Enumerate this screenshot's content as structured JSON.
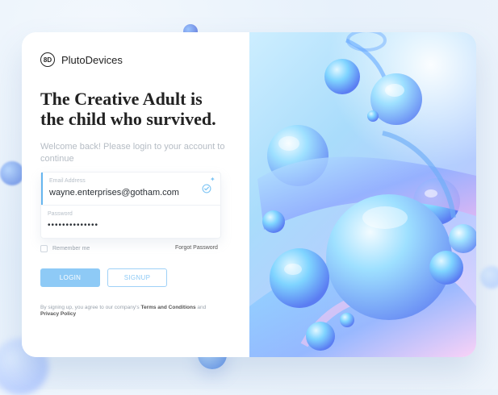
{
  "brand": {
    "name": "PlutoDevices",
    "logo_text": "8D"
  },
  "headline": {
    "line1": "The Creative Adult is",
    "line2": "the child who survived."
  },
  "intro": {
    "text": "Welcome back! Please login to your account to continue"
  },
  "form": {
    "email_label": "Email Address",
    "email_value": "wayne.enterprises@gotham.com",
    "password_label": "Password",
    "password_value": "••••••••••••••",
    "remember_label": "Remember me",
    "forgot_label": "Forgot Password"
  },
  "actions": {
    "login_label": "LOGIN",
    "signup_label": "SIGNUP"
  },
  "footer": {
    "terms_prefix": "By signing up, you agree to our company's ",
    "terms_link": "Terms and Conditions",
    "terms_middle": " and ",
    "privacy_link": "Privacy Policy"
  },
  "colors": {
    "accent": "#8ecaf6",
    "text_dark": "#222222",
    "text_muted": "#b5bcc4"
  },
  "icons": {
    "brand": "brand-logo-icon",
    "verified": "verified-icon",
    "sparkle": "sparkle-icon"
  }
}
